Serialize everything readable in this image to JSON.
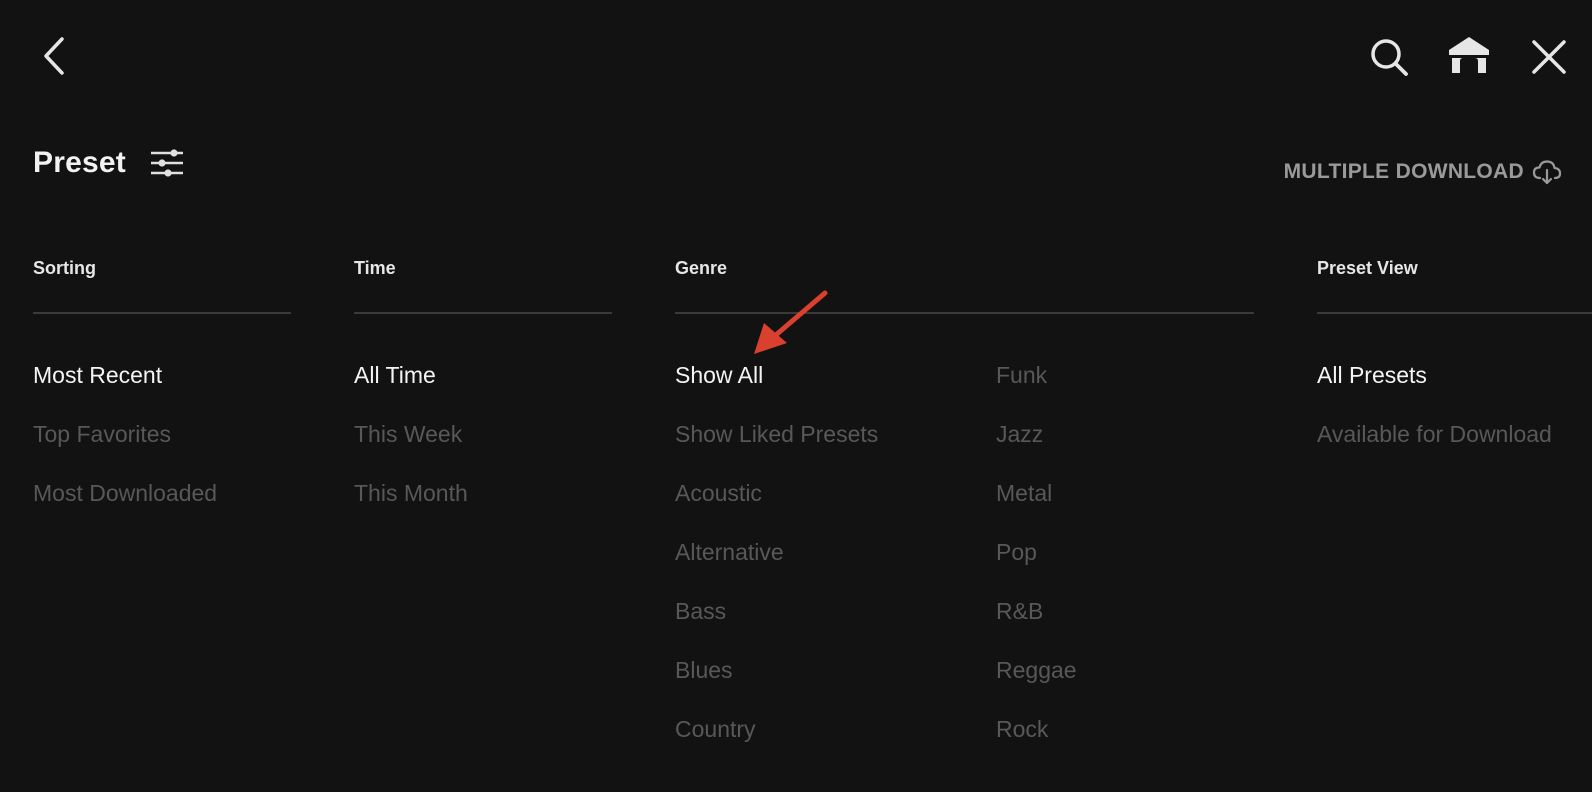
{
  "header": {
    "title": "Preset",
    "multiple_download_label": "MULTIPLE DOWNLOAD",
    "icons": {
      "back": "chevron-left-icon",
      "search": "search-icon",
      "home": "home-icon",
      "close": "close-icon",
      "filter": "sliders-icon",
      "download": "cloud-download-icon"
    }
  },
  "filters": {
    "sorting": {
      "label": "Sorting",
      "options": [
        "Most Recent",
        "Top Favorites",
        "Most Downloaded"
      ],
      "selected": "Most Recent"
    },
    "time": {
      "label": "Time",
      "options": [
        "All Time",
        "This Week",
        "This Month"
      ],
      "selected": "All Time"
    },
    "genre": {
      "label": "Genre",
      "options_col1": [
        "Show All",
        "Show Liked Presets",
        "Acoustic",
        "Alternative",
        "Bass",
        "Blues",
        "Country"
      ],
      "options_col2": [
        "Funk",
        "Jazz",
        "Metal",
        "Pop",
        "R&B",
        "Reggae",
        "Rock"
      ],
      "selected": "Show All"
    },
    "preset_view": {
      "label": "Preset View",
      "options": [
        "All Presets",
        "Available for Download"
      ],
      "selected": "All Presets"
    }
  },
  "colors": {
    "background": "#121212",
    "selected_text": "#f4f4f4",
    "unselected_text": "#585858",
    "divider": "#3a3a3a",
    "annotation_arrow": "#d9402e"
  }
}
